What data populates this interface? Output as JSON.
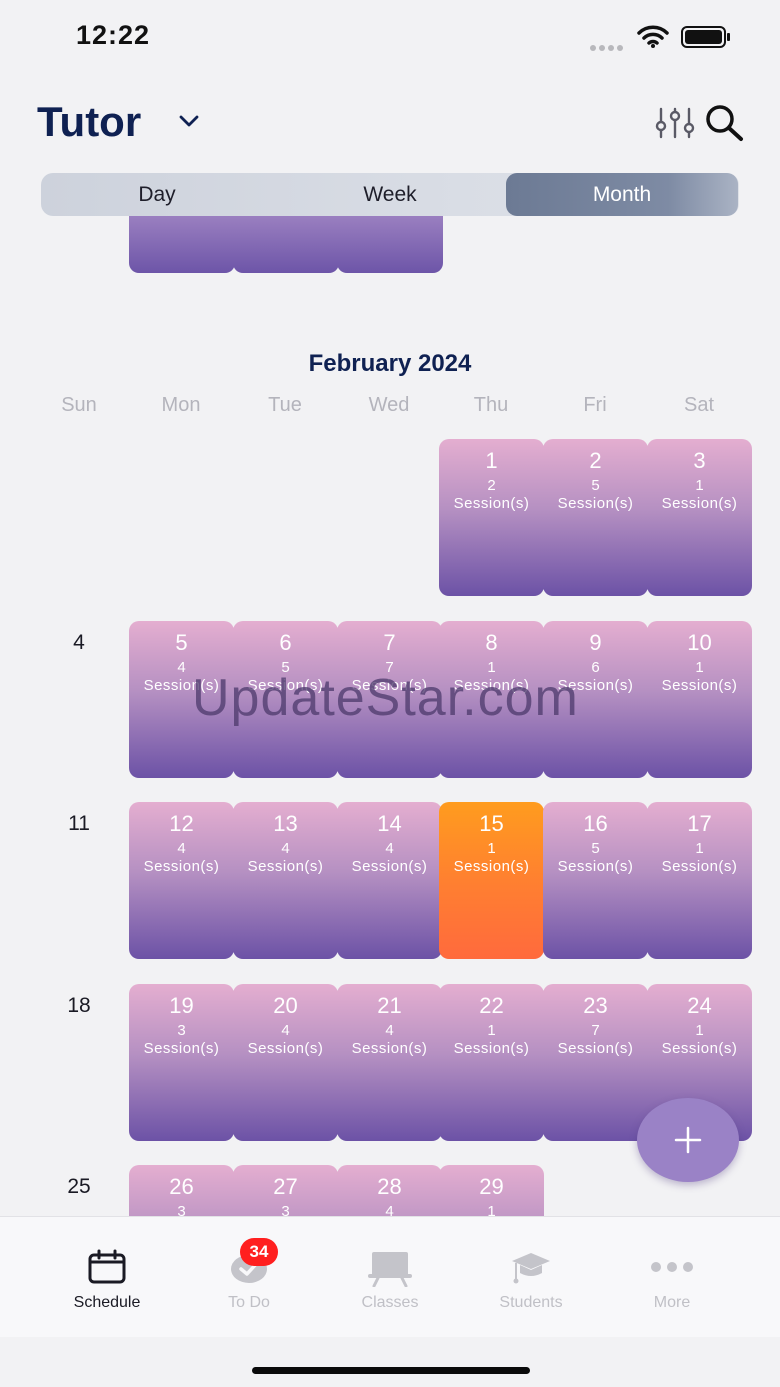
{
  "status_bar": {
    "time": "12:22"
  },
  "header": {
    "title": "Tutor"
  },
  "view_toggle": {
    "options": [
      "Day",
      "Week",
      "Month"
    ],
    "selected": "Month"
  },
  "calendar": {
    "month_title": "February 2024",
    "weekdays": [
      "Sun",
      "Mon",
      "Tue",
      "Wed",
      "Thu",
      "Fri",
      "Sat"
    ],
    "session_label": "Session(s)",
    "today": "15",
    "weeks": [
      {
        "week_label": "",
        "days": [
          {
            "col": 4,
            "day": "1",
            "count": "2"
          },
          {
            "col": 5,
            "day": "2",
            "count": "5"
          },
          {
            "col": 6,
            "day": "3",
            "count": "1"
          }
        ]
      },
      {
        "week_label": "4",
        "days": [
          {
            "col": 1,
            "day": "5",
            "count": "4"
          },
          {
            "col": 2,
            "day": "6",
            "count": "5"
          },
          {
            "col": 3,
            "day": "7",
            "count": "7"
          },
          {
            "col": 4,
            "day": "8",
            "count": "1"
          },
          {
            "col": 5,
            "day": "9",
            "count": "6"
          },
          {
            "col": 6,
            "day": "10",
            "count": "1"
          }
        ]
      },
      {
        "week_label": "11",
        "days": [
          {
            "col": 1,
            "day": "12",
            "count": "4"
          },
          {
            "col": 2,
            "day": "13",
            "count": "4"
          },
          {
            "col": 3,
            "day": "14",
            "count": "4"
          },
          {
            "col": 4,
            "day": "15",
            "count": "1"
          },
          {
            "col": 5,
            "day": "16",
            "count": "5"
          },
          {
            "col": 6,
            "day": "17",
            "count": "1"
          }
        ]
      },
      {
        "week_label": "18",
        "days": [
          {
            "col": 1,
            "day": "19",
            "count": "3"
          },
          {
            "col": 2,
            "day": "20",
            "count": "4"
          },
          {
            "col": 3,
            "day": "21",
            "count": "4"
          },
          {
            "col": 4,
            "day": "22",
            "count": "1"
          },
          {
            "col": 5,
            "day": "23",
            "count": "7"
          },
          {
            "col": 6,
            "day": "24",
            "count": "1"
          }
        ]
      },
      {
        "week_label": "25",
        "days": [
          {
            "col": 1,
            "day": "26",
            "count": "3"
          },
          {
            "col": 2,
            "day": "27",
            "count": "3"
          },
          {
            "col": 3,
            "day": "28",
            "count": "4"
          },
          {
            "col": 4,
            "day": "29",
            "count": "1"
          }
        ]
      }
    ]
  },
  "watermark": "UpdateStar.com",
  "tabbar": {
    "items": [
      {
        "label": "Schedule",
        "icon": "calendar-icon",
        "active": true
      },
      {
        "label": "To Do",
        "icon": "todo-check-icon",
        "active": false
      },
      {
        "label": "Classes",
        "icon": "classroom-board-icon",
        "active": false
      },
      {
        "label": "Students",
        "icon": "graduation-cap-icon",
        "active": false
      },
      {
        "label": "More",
        "icon": "more-dots-icon",
        "active": false
      }
    ],
    "todo_badge": "34"
  },
  "colors": {
    "cell_top": "#e4aed0",
    "cell_bottom": "#6c52a6",
    "today_top": "#ff9c1e",
    "today_bottom": "#ff6a3d",
    "title": "#0f2152",
    "badge": "#ff1f1f",
    "fab": "#9a82c6"
  }
}
